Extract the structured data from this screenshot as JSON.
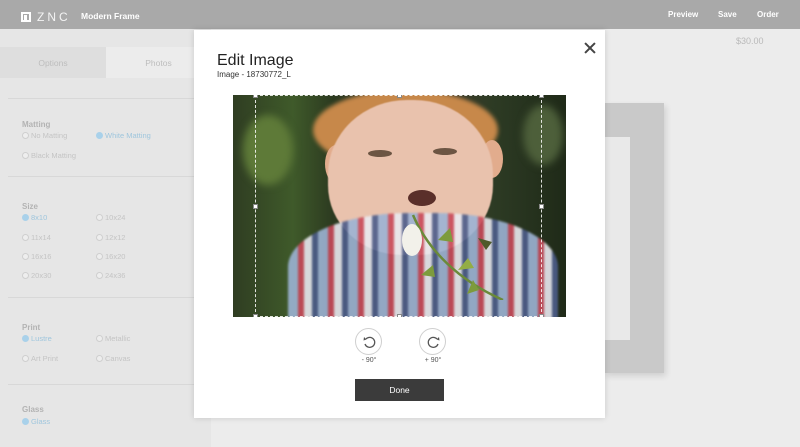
{
  "header": {
    "logo_text": "ZNC",
    "title": "Modern Frame",
    "nav": [
      "Preview",
      "Save",
      "Order"
    ]
  },
  "sidebar": {
    "tabs": [
      "Options",
      "Photos"
    ],
    "matting": {
      "title": "Matting",
      "options": [
        "No Matting",
        "White Matting",
        "Black Matting"
      ],
      "selected": "White Matting"
    },
    "size": {
      "title": "Size",
      "options": [
        "8x10",
        "10x24",
        "11x14",
        "12x12",
        "16x16",
        "16x20",
        "20x30",
        "24x36"
      ],
      "selected": "8x10"
    },
    "print": {
      "title": "Print",
      "options": [
        "Lustre",
        "Metallic",
        "Art Print",
        "Canvas"
      ],
      "selected": "Lustre"
    },
    "glass": {
      "title": "Glass",
      "options": [
        "Glass"
      ],
      "selected": "Glass"
    }
  },
  "main": {
    "price": "$30.00"
  },
  "modal": {
    "title": "Edit Image",
    "subtitle": "Image - 18730772_L",
    "rotate_left_label": "- 90°",
    "rotate_right_label": "+ 90°",
    "done_label": "Done"
  },
  "colors": {
    "accent": "#a9d1ea",
    "topbar": "#a9a9a9",
    "done_button": "#3b3b3b"
  }
}
